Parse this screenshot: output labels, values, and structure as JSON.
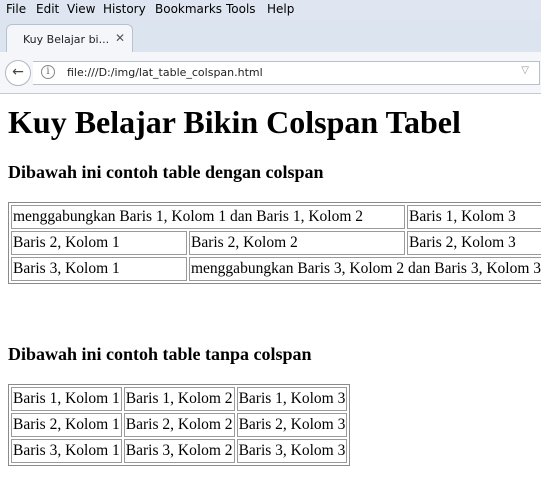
{
  "browser": {
    "menu": [
      {
        "label": "File"
      },
      {
        "label": "Edit"
      },
      {
        "label": "View"
      },
      {
        "label": "History"
      },
      {
        "label": "Bookmarks"
      },
      {
        "label": "Tools"
      },
      {
        "label": "Help"
      }
    ],
    "tab": {
      "title": "Kuy Belajar bi...",
      "close": "✕"
    },
    "back_icon": "←",
    "info_icon": "i",
    "url": "file:///D:/img/lat_table_colspan.html",
    "dropdown_icon": "▽"
  },
  "page": {
    "title": "Kuy Belajar Bikin Colspan Tabel",
    "heading1": "Dibawah ini contoh table dengan colspan",
    "heading2": "Dibawah ini contoh table tanpa colspan",
    "table1": {
      "rows": [
        [
          "menggabungkan Baris 1, Kolom 1 dan Baris 1, Kolom 2",
          "Baris 1, Kolom 3"
        ],
        [
          "Baris 2, Kolom 1",
          "Baris 2, Kolom 2",
          "Baris 2, Kolom 3"
        ],
        [
          "Baris 3, Kolom 1",
          "menggabungkan Baris 3, Kolom 2 dan Baris 3, Kolom 3"
        ]
      ]
    },
    "table2": {
      "rows": [
        [
          "Baris 1, Kolom 1",
          "Baris 1, Kolom 2",
          "Baris 1, Kolom 3"
        ],
        [
          "Baris 2, Kolom 1",
          "Baris 2, Kolom 2",
          "Baris 2, Kolom 3"
        ],
        [
          "Baris 3, Kolom 1",
          "Baris 3, Kolom 2",
          "Baris 3, Kolom 3"
        ]
      ]
    }
  }
}
